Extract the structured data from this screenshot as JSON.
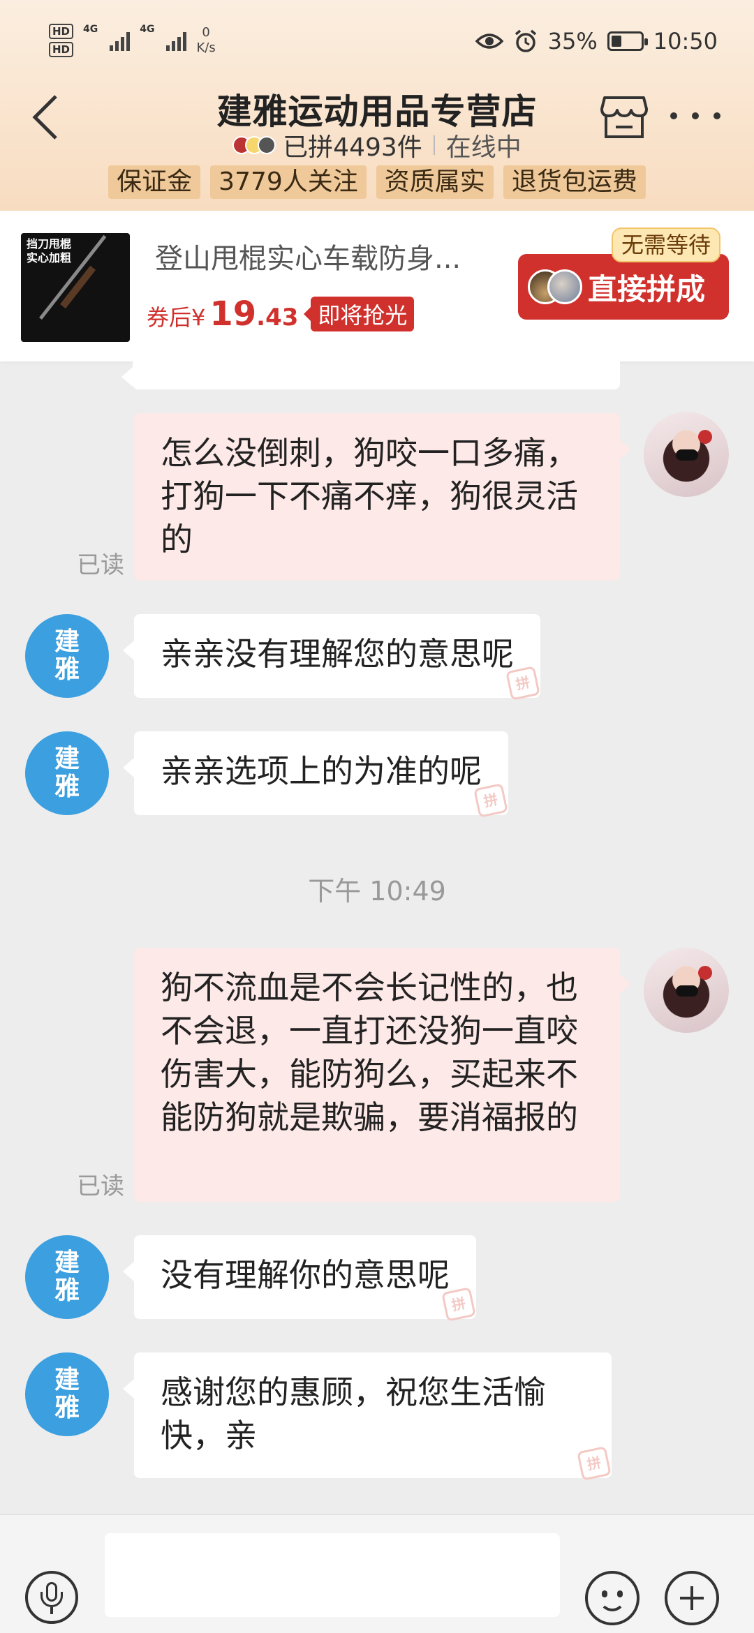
{
  "status_bar": {
    "hd1": "HD",
    "hd2": "HD",
    "sim1_net": "4G",
    "sim2_net": "4G",
    "speed_value": "0",
    "speed_unit": "K/s",
    "battery": "35%",
    "time": "10:50"
  },
  "header": {
    "store_name": "建雅运动用品专营店",
    "sold_count": "已拼4493件",
    "online_status": "在线中",
    "tags": [
      "保证金",
      "3779人关注",
      "资质属实",
      "退货包运费"
    ]
  },
  "product": {
    "image_text": "挡刀甩棍\n实心加粗",
    "title": "登山甩棍实心车载防身...",
    "price_label": "券后¥",
    "price_int": "19",
    "price_dec": ".43",
    "urgency_badge": "即将抢光",
    "no_wait_badge": "无需等待",
    "buy_button": "直接拼成"
  },
  "chat": {
    "shop_avatar_text": [
      "建",
      "雅"
    ],
    "messages": [
      {
        "from": "me",
        "text": "怎么没倒刺，狗咬一口多痛，打狗一下不痛不痒，狗很灵活的",
        "read": "已读"
      },
      {
        "from": "shop",
        "text": "亲亲没有理解您的意思呢"
      },
      {
        "from": "shop",
        "text": "亲亲选项上的为准的呢"
      },
      {
        "time": "下午 10:49"
      },
      {
        "from": "me",
        "text": "狗不流血是不会长记性的，也不会退，一直打还没狗一直咬伤害大，能防狗么，买起来不能防狗就是欺骗，要消福报的",
        "read": "已读"
      },
      {
        "from": "shop",
        "text": "没有理解你的意思呢"
      },
      {
        "from": "shop",
        "text": "感谢您的惠顾，祝您生活愉快，亲"
      }
    ]
  },
  "colors": {
    "accent_red": "#d0312d",
    "shop_avatar_blue": "#3b9fe0",
    "my_bubble": "#fde9e7"
  }
}
